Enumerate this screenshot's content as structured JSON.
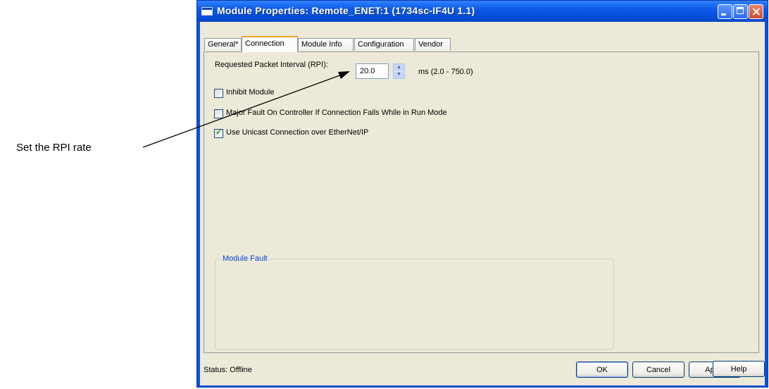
{
  "annotation": {
    "label": "Set the RPI rate"
  },
  "window": {
    "title": "Module Properties: Remote_ENET:1 (1734sc-IF4U 1.1)",
    "controls": [
      "minimize-icon",
      "maximize-icon",
      "close-icon"
    ]
  },
  "tabs": [
    {
      "label": "General*",
      "active": false
    },
    {
      "label": "Connection",
      "active": true
    },
    {
      "label": "Module Info",
      "active": false
    },
    {
      "label": "Configuration",
      "active": false
    },
    {
      "label": "Vendor",
      "active": false
    }
  ],
  "connection": {
    "rpi_label": "Requested Packet Interval (RPI):",
    "rpi_value": "20.0",
    "rpi_range": "ms (2.0 - 750.0)",
    "options": [
      {
        "label": "Inhibit Module",
        "checked": false
      },
      {
        "label": "Major Fault On Controller If Connection Fails While in Run Mode",
        "checked": false
      },
      {
        "label": "Use Unicast Connection over EtherNet/IP",
        "checked": true
      }
    ],
    "fault_group_title": "Module Fault"
  },
  "status": {
    "text": "Status:  Offline"
  },
  "buttons": {
    "ok": "OK",
    "cancel": "Cancel",
    "apply": "Apply",
    "help": "Help"
  },
  "colors": {
    "titlebar": "#0a53d8",
    "dialog_bg": "#ece9d8",
    "active_tab_accent": "#f0a52b",
    "group_title": "#0046d5",
    "check": "#21a121"
  }
}
